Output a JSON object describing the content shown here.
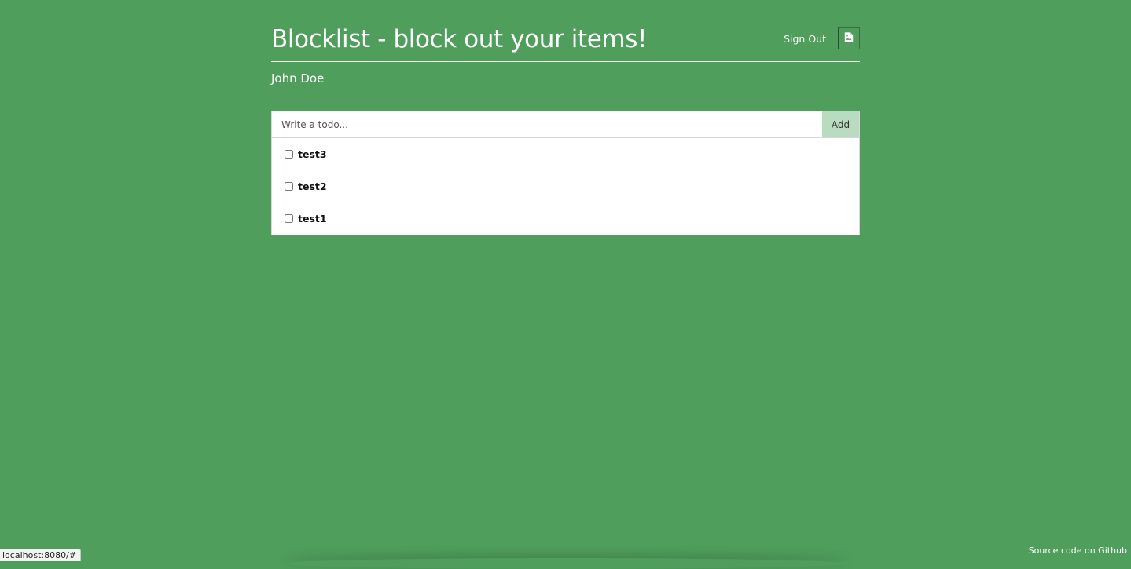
{
  "header": {
    "title": "Blocklist - block out your items!",
    "signout_label": "Sign Out",
    "avatar_icon": "broken-image-icon"
  },
  "user": {
    "name": "John Doe"
  },
  "todo_form": {
    "input_value": "",
    "input_placeholder": "Write a todo...",
    "add_label": "Add"
  },
  "todos": [
    {
      "label": "test3",
      "checked": false
    },
    {
      "label": "test2",
      "checked": false
    },
    {
      "label": "test1",
      "checked": false
    }
  ],
  "footer": {
    "source_link": "Source code on Github"
  },
  "browser_status": {
    "url": "localhost:8080/#"
  },
  "colors": {
    "background": "#4f9e5c",
    "add_button": "#b9dcc0",
    "panel": "#ffffff"
  }
}
